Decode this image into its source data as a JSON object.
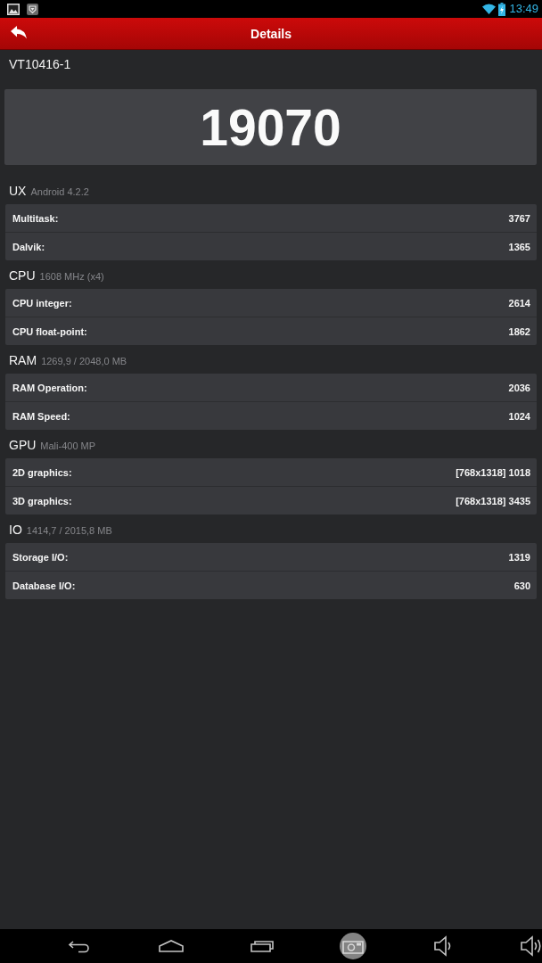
{
  "status_bar": {
    "time": "13:49"
  },
  "header": {
    "title": "Details"
  },
  "device": {
    "name": "VT10416-1"
  },
  "score": {
    "total": "19070"
  },
  "sections": [
    {
      "title": "UX",
      "subtitle": "Android 4.2.2",
      "rows": [
        {
          "label": "Multitask:",
          "value": "3767"
        },
        {
          "label": "Dalvik:",
          "value": "1365"
        }
      ]
    },
    {
      "title": "CPU",
      "subtitle": "1608 MHz (x4)",
      "rows": [
        {
          "label": "CPU integer:",
          "value": "2614"
        },
        {
          "label": "CPU float-point:",
          "value": "1862"
        }
      ]
    },
    {
      "title": "RAM",
      "subtitle": "1269,9 / 2048,0 MB",
      "rows": [
        {
          "label": "RAM Operation:",
          "value": "2036"
        },
        {
          "label": "RAM Speed:",
          "value": "1024"
        }
      ]
    },
    {
      "title": "GPU",
      "subtitle": "Mali-400 MP",
      "rows": [
        {
          "label": "2D graphics:",
          "value": "[768x1318] 1018"
        },
        {
          "label": "3D graphics:",
          "value": "[768x1318] 3435"
        }
      ]
    },
    {
      "title": "IO",
      "subtitle": "1414,7 / 2015,8 MB",
      "rows": [
        {
          "label": "Storage I/O:",
          "value": "1319"
        },
        {
          "label": "Database I/O:",
          "value": "630"
        }
      ]
    }
  ],
  "nav_bar": {
    "buttons": [
      {
        "kind": "back",
        "pressed": false
      },
      {
        "kind": "home",
        "pressed": false
      },
      {
        "kind": "recents",
        "pressed": false
      },
      {
        "kind": "screenshot",
        "pressed": true
      },
      {
        "kind": "volume_down",
        "pressed": false
      },
      {
        "kind": "volume_up",
        "pressed": false
      }
    ]
  }
}
